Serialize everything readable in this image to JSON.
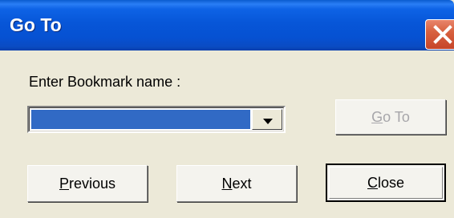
{
  "window": {
    "title": "Go To"
  },
  "dialog": {
    "prompt_label": "Enter Bookmark name :",
    "bookmark_combo_value": "",
    "buttons": {
      "goto": {
        "mnemonic": "G",
        "rest": "o To",
        "enabled": false
      },
      "previous": {
        "mnemonic": "P",
        "rest": "revious"
      },
      "next": {
        "mnemonic": "N",
        "rest": "ext"
      },
      "close": {
        "mnemonic": "C",
        "rest": "lose",
        "default": true
      }
    }
  },
  "colors": {
    "titlebar": "#0756d8",
    "selection": "#316ac5",
    "close_button": "#d8613f",
    "face": "#ece9d8",
    "disabled_text": "#a7a6aa"
  },
  "icons": {
    "close": "close-icon",
    "dropdown": "chevron-down-icon"
  }
}
